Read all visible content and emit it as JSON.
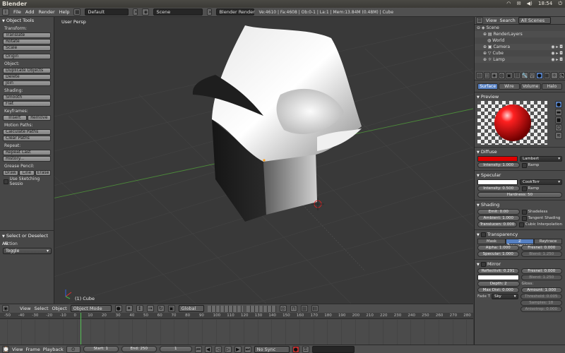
{
  "window_title": "Blender",
  "tray": {
    "time": "18:54"
  },
  "menu": {
    "items": [
      "File",
      "Add",
      "Render",
      "Help"
    ],
    "layout": "Default",
    "scene": "Scene",
    "engine": "Blender Render",
    "stats": "Ve:4610 | Fa:4608 | Ob:0-1 | La:1 | Mem:13.84M (0.48M) | Cube"
  },
  "tools": {
    "panel_title": "Object Tools",
    "transform_label": "Transform:",
    "translate": "Translate",
    "rotate": "Rotate",
    "scale": "Scale",
    "origin": "Origin",
    "object_label": "Object:",
    "duplicate": "Duplicate Objects",
    "delete": "Delete",
    "join": "Join",
    "shading_label": "Shading:",
    "smooth": "Smooth",
    "flat": "Flat",
    "keyframes_label": "Keyframes:",
    "insert": "Insert",
    "remove": "Remove",
    "motion_label": "Motion Paths:",
    "calc_paths": "Calculate Paths",
    "clear_paths": "Clear Paths",
    "repeat_label": "Repeat:",
    "repeat_last": "Repeat Last",
    "history": "History...",
    "grease_label": "Grease Pencil:",
    "draw": "Draw",
    "line": "Line",
    "erase": "Erase",
    "sketching": "Use Sketching Sessio",
    "op_title": "Select or Deselect All",
    "action_label": "Action",
    "action_value": "Toggle"
  },
  "viewport": {
    "view_label": "User Persp",
    "object_label": "(1) Cube"
  },
  "view_header": {
    "items": [
      "View",
      "Select",
      "Object"
    ],
    "mode": "Object Mode",
    "orientation": "Global"
  },
  "timeline": {
    "ticks": [
      "-50",
      "-40",
      "-30",
      "-20",
      "-10",
      "0",
      "10",
      "20",
      "30",
      "40",
      "50",
      "60",
      "70",
      "80",
      "90",
      "100",
      "110",
      "120",
      "130",
      "140",
      "150",
      "160",
      "170",
      "180",
      "190",
      "200",
      "210",
      "220",
      "230",
      "240",
      "250",
      "260",
      "270",
      "280"
    ]
  },
  "footer": {
    "items": [
      "View",
      "Frame",
      "Playback"
    ],
    "start": "Start: 1",
    "end": "End: 250",
    "current": "1",
    "sync": "No Sync"
  },
  "outliner": {
    "view": "View",
    "search": "Search",
    "scenes": "All Scenes",
    "rows": [
      "Scene",
      "RenderLayers",
      "World",
      "Camera",
      "Cube",
      "Lamp"
    ]
  },
  "properties": {
    "tabs": [
      "Surface",
      "Wire",
      "Volume",
      "Halo"
    ],
    "preview": "Preview",
    "diffuse": {
      "title": "Diffuse",
      "shader": "Lambert",
      "intensity": "Intensity: 1.000",
      "ramp": "Ramp",
      "color": "#e00000"
    },
    "specular": {
      "title": "Specular",
      "shader": "CookTorr",
      "intensity": "Intensity: 0.500",
      "ramp": "Ramp",
      "hardness": "Hardness: 50",
      "color": "#ffffff"
    },
    "shading": {
      "title": "Shading",
      "emit": "Emit: 0.00",
      "ambient": "Ambient: 1.000",
      "translucency": "Translucen: 0.000",
      "shadeless": "Shadeless",
      "tangent": "Tangent Shading",
      "cubic": "Cubic Interpolation"
    },
    "transparency": {
      "title": "Transparency",
      "modes": [
        "Mask",
        "Z Transparency",
        "Raytrace"
      ],
      "alpha": "Alpha: 1.000",
      "specular": "Specular: 1.000",
      "fresnel": "Fresnel: 0.000",
      "blend": "Blend: 1.250"
    },
    "mirror": {
      "title": "Mirror",
      "reflectivity": "Reflectivit: 0.291",
      "fresnel": "Fresnel: 0.000",
      "blend": "Blend: 1.250",
      "depth": "Depth: 2",
      "max_dist": "Max Dist: 0.000",
      "fade_label": "Fade T",
      "fade": "Sky",
      "gloss_label": "Gloss:",
      "amount": "Amount: 1.000",
      "threshold": "Threshold: 0.005",
      "samples": "Samples: 18",
      "aniso": "Anisotrop: 0.000"
    }
  },
  "colors": {
    "accent": "#5680c2",
    "viewport_bg": "#393939",
    "frame_line": "#55c055"
  }
}
